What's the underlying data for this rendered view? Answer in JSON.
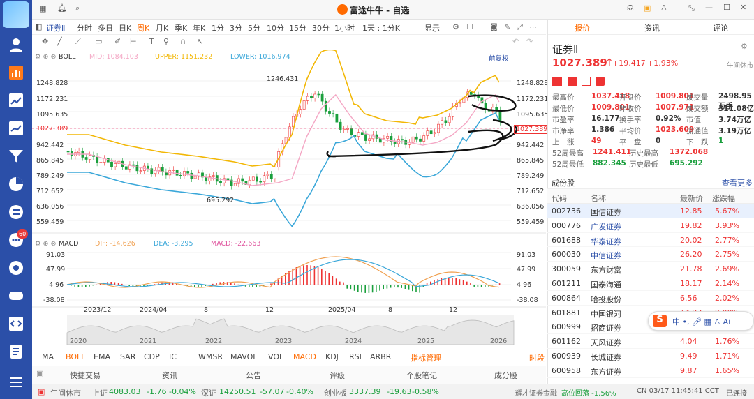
{
  "window": {
    "title": "富途牛牛 - 自选"
  },
  "toolbar": {
    "symbol": "证券Ⅱ",
    "periods": [
      "分时",
      "多日",
      "日K",
      "周K",
      "月K",
      "季K",
      "年K",
      "1分",
      "3分",
      "5分",
      "10分",
      "15分",
      "30分",
      "1小时",
      "1天 : 1分K"
    ],
    "active_period": "周K",
    "display": "显示"
  },
  "boll": {
    "label": "BOLL",
    "mid": "MID: 1084.103",
    "upper": "UPPER: 1151.232",
    "lower": "LOWER: 1016.974",
    "adjust": "前复权"
  },
  "price_axis": [
    "1248.828",
    "1172.231",
    "1095.635",
    "1027.389",
    "942.442",
    "865.845",
    "789.249",
    "712.652",
    "636.056",
    "559.459"
  ],
  "annotations": {
    "high": "1246.431",
    "low": "695.292"
  },
  "macd": {
    "label": "MACD",
    "dif": "DIF: -14.626",
    "dea": "DEA: -3.295",
    "macd": "MACD: -22.663",
    "axis": [
      "91.03",
      "47.99",
      "4.96",
      "-38.08"
    ]
  },
  "time_axis": [
    "2023/12",
    "2024/04",
    "8",
    "12",
    "2025/04",
    "8",
    "12"
  ],
  "overview_axis": [
    "2020",
    "2021",
    "2022",
    "2023",
    "2024",
    "2025",
    "2026"
  ],
  "indicators": [
    "MA",
    "BOLL",
    "EMA",
    "SAR",
    "CDP",
    "IC",
    "WMSR",
    "MAVOL",
    "VOL",
    "MACD",
    "KDJ",
    "RSI",
    "ARBR",
    "指标管理",
    "时段"
  ],
  "bottom_tabs": [
    "快捷交易",
    "资讯",
    "公告",
    "评级",
    "个股笔记",
    "成分股"
  ],
  "right_tabs": [
    "报价",
    "资讯",
    "评论"
  ],
  "quote": {
    "name": "证券Ⅱ",
    "status": "午间休市",
    "price": "1027.389",
    "change": "+19.417",
    "pct": "+1.93%",
    "rows": [
      [
        "最高价",
        "1037.418",
        "开盘价",
        "1009.801",
        "成交量",
        "2498.95万手"
      ],
      [
        "最低价",
        "1009.801",
        "昨收价",
        "1007.971",
        "成交额",
        "311.08亿"
      ],
      [
        "市盈率",
        "16.177",
        "换手率",
        "0.92%",
        "市值",
        "3.74万亿"
      ],
      [
        "市净率",
        "1.386",
        "平均价",
        "1023.609",
        "流通值",
        "3.19万亿"
      ],
      [
        "上　涨",
        "49",
        "平　盘",
        "0",
        "下　跌",
        "1"
      ],
      [
        "52周最高",
        "1241.411",
        "历史最高",
        "1372.068",
        "",
        ""
      ],
      [
        "52周最低",
        "882.345",
        "历史最低",
        "695.292",
        "",
        ""
      ]
    ]
  },
  "watchlist": {
    "title": "成份股",
    "more": "查看更多",
    "headers": [
      "代码",
      "名称",
      "最新价",
      "涨跌幅"
    ],
    "rows": [
      [
        "002736",
        "国信证券",
        "12.85",
        "5.67%"
      ],
      [
        "000776",
        "广发证券",
        "19.82",
        "3.93%"
      ],
      [
        "601688",
        "华泰证券",
        "20.02",
        "2.77%"
      ],
      [
        "600030",
        "中信证券",
        "26.20",
        "2.75%"
      ],
      [
        "300059",
        "东方财富",
        "21.78",
        "2.69%"
      ],
      [
        "601211",
        "国泰海通",
        "18.17",
        "2.14%"
      ],
      [
        "600864",
        "哈投股份",
        "6.56",
        "2.02%"
      ],
      [
        "601881",
        "中国银河",
        "14.27",
        "2.00%"
      ],
      [
        "600999",
        "招商证券",
        "19.10",
        "1.89%"
      ],
      [
        "601162",
        "天风证券",
        "4.04",
        "1.76%"
      ],
      [
        "600939",
        "长城证券",
        "9.49",
        "1.71%"
      ],
      [
        "600958",
        "东方证券",
        "9.87",
        "1.65%"
      ]
    ]
  },
  "statusbar": {
    "session": "午间休市",
    "sh": "上证",
    "sh_v": "4083.03",
    "sh_c": "-1.76",
    "sh_p": "-0.04%",
    "sz": "深证",
    "sz_v": "14250.51",
    "sz_c": "-57.07",
    "sz_p": "-0.40%",
    "cy": "创业板",
    "cy_v": "3337.39",
    "cy_c": "-19.63",
    "cy_p": "-0.58%",
    "broker": "耀才证券金融",
    "alert": "高位回落 -1.56%",
    "time": "CN 03/17 11:45:41 CCT",
    "conn": "已连接"
  },
  "colors": {
    "up": "#e33333",
    "down": "#1a9f3d",
    "upper": "#f2b705",
    "mid": "#f4a6c4",
    "lower": "#3aa7d9",
    "sidebar": "#2b4fa8"
  },
  "badge": "60"
}
